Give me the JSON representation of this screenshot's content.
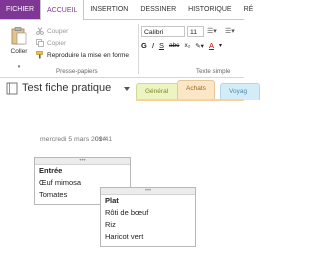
{
  "ribbon_tabs": [
    "FICHIER",
    "ACCUEIL",
    "INSERTION",
    "DESSINER",
    "HISTORIQUE",
    "RÉ"
  ],
  "clipboard": {
    "paste": "Coller",
    "cut": "Couper",
    "copy": "Copier",
    "format_painter": "Reproduire la mise en forme",
    "group_label": "Presse-papiers"
  },
  "text": {
    "font": "Calibri",
    "size": "11",
    "group_label": "Texte simple",
    "bold": "G",
    "italic": "I",
    "underline": "S",
    "strike": "abc",
    "subscript": "x₂"
  },
  "notebook": {
    "title": "Test fiche pratique"
  },
  "sections": [
    "Général",
    "Achats",
    "Voyag"
  ],
  "page": {
    "date": "mercredi 5 mars 2014",
    "time": "09:41"
  },
  "note1": [
    "Entrée",
    "Œuf mimosa",
    "Tomates"
  ],
  "note2": [
    "Plat",
    "Rôti de bœuf",
    "Riz",
    "Haricot vert"
  ],
  "colors": {
    "file_tab": "#7e3795",
    "section_general": "#eef3c2",
    "section_achats": "#fbe6c6",
    "section_voyage": "#d4ecf7"
  }
}
